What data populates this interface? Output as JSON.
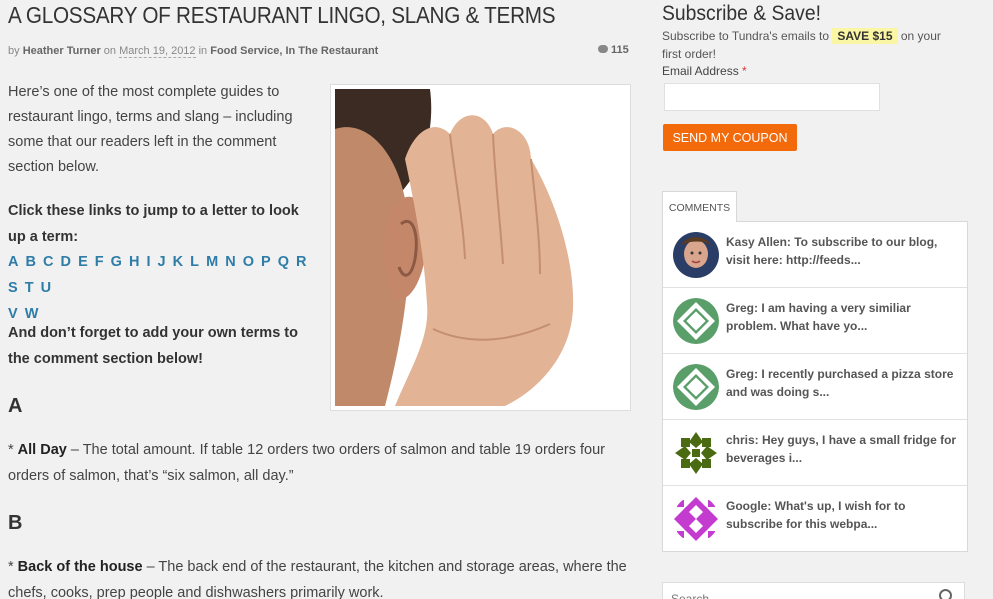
{
  "post": {
    "title": "A GLOSSARY OF RESTAURANT LINGO, SLANG & TERMS",
    "meta_by": "by",
    "author": "Heather Turner",
    "meta_on": "on",
    "date": "March 19, 2012",
    "meta_in": "in",
    "category1": "Food Service",
    "category_sep": ",",
    "category2": "In The Restaurant",
    "comment_count": "115",
    "intro": "Here’s one of the most complete guides to restaurant lingo, terms and slang – including some that our readers left in the comment section below.",
    "lead": "Click these links to jump to a letter to look up a term:",
    "letters": [
      "A",
      "B",
      "C",
      "D",
      "E",
      "F",
      "G",
      "H",
      "I",
      "J",
      "K",
      "L",
      "M",
      "N",
      "O",
      "P",
      "Q",
      "R",
      "S",
      "T",
      "U",
      "V",
      "W"
    ],
    "forget": "And don’t forget to add your own terms to the comment section below!",
    "section_a": "A",
    "entry_a_prefix": "* ",
    "entry_a_term": "All Day",
    "entry_a_def": " – The total amount.  If table 12 orders two orders of salmon and table 19 orders four orders of salmon, that’s “six salmon, all day.”",
    "section_b": "B",
    "entry_b_prefix": "* ",
    "entry_b_term": "Back of the house",
    "entry_b_def": " – The back end of the restaurant, the kitchen and storage areas, where the chefs, cooks, prep people and dishwashers primarily work."
  },
  "sidebar": {
    "subscribe_title": "Subscribe & Save!",
    "subscribe_text_a": "Subscribe to Tundra's emails to ",
    "save_badge": "SAVE $15",
    "subscribe_text_b": " on your first order!",
    "email_label": "Email Address",
    "email_required": "*",
    "email_value": "",
    "send_button": "SEND MY COUPON",
    "comments_tab": "COMMENTS",
    "comments": [
      {
        "text": "Kasy Allen: To subscribe to our blog, visit here: http://feeds...",
        "avatar": "photo"
      },
      {
        "text": "Greg: I am having a very similiar problem. What have yo...",
        "avatar": "identicon-green"
      },
      {
        "text": "Greg: I recently purchased a pizza store and was doing s...",
        "avatar": "identicon-green"
      },
      {
        "text": "chris: Hey guys, I have a small fridge for beverages i...",
        "avatar": "identicon-olive"
      },
      {
        "text": "Google: What's up, I wish for to subscribe for this webpa...",
        "avatar": "identicon-magenta"
      }
    ],
    "search_placeholder": "Search..."
  },
  "colors": {
    "accent_link": "#2e7da8",
    "button_orange": "#f26a0a",
    "badge_yellow": "#fbf6a3",
    "identicon_green": "#5a9e6a",
    "identicon_olive": "#4a6b12",
    "identicon_magenta": "#c43bcf"
  }
}
